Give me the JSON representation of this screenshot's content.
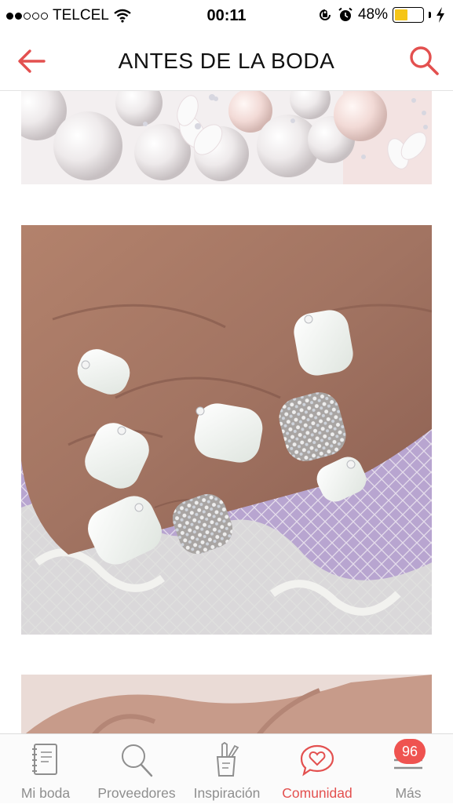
{
  "status_bar": {
    "carrier": "TELCEL",
    "time": "00:11",
    "battery_percent": "48%",
    "battery_level": 0.48,
    "battery_color": "#f5c518",
    "signal_bars_filled": 2,
    "signal_bars_total": 5,
    "icons": [
      "wifi-icon",
      "orientation-lock-icon",
      "alarm-icon",
      "charging-bolt-icon"
    ]
  },
  "nav": {
    "title": "ANTES DE LA BODA",
    "accent_color": "#e3504f",
    "icons": [
      "back-arrow-icon",
      "search-icon"
    ]
  },
  "content": {
    "photos": [
      {
        "subject": "pearls-and-crystal-flowers"
      },
      {
        "subject": "white-manicure-with-rhinestones"
      },
      {
        "subject": "manicure-partial"
      }
    ]
  },
  "tab_bar": {
    "items": [
      {
        "label": "Mi boda",
        "icon": "notebook-icon",
        "active": false
      },
      {
        "label": "Proveedores",
        "icon": "search-icon",
        "active": false
      },
      {
        "label": "Inspiración",
        "icon": "pencil-cup-icon",
        "active": false
      },
      {
        "label": "Comunidad",
        "icon": "heart-bubble-icon",
        "active": true
      },
      {
        "label": "Más",
        "icon": "menu-icon",
        "active": false
      }
    ],
    "badge": "96",
    "active_color": "#e3504f",
    "inactive_color": "#8e8e8e"
  }
}
